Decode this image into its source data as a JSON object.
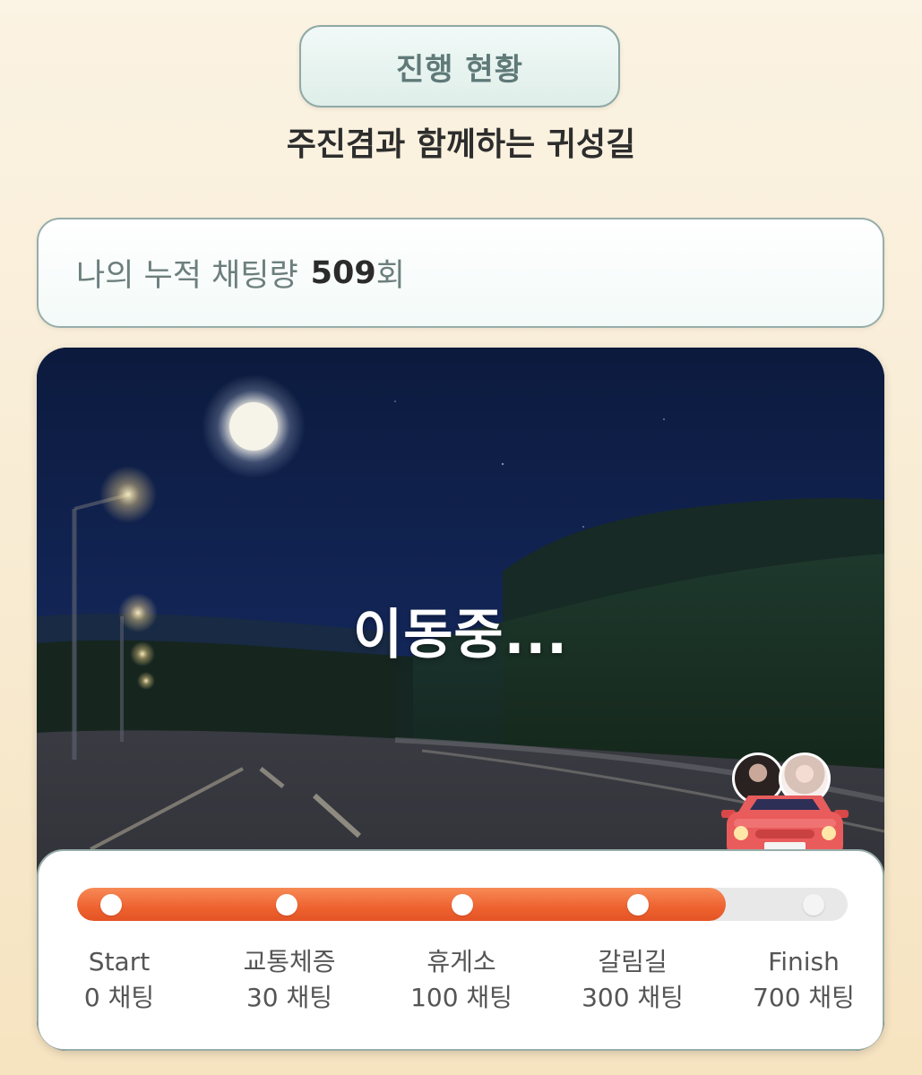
{
  "header": {
    "title": "진행 현황",
    "subtitle": "주진겸과 함께하는 귀성길"
  },
  "stats": {
    "label": "나의 누적 채팅량",
    "value": "509",
    "unit": "회"
  },
  "scene": {
    "status_text": "이동중..."
  },
  "progress": {
    "fill_fraction": 0.842,
    "milestones": [
      {
        "name": "Start",
        "requirement": "0 채팅",
        "reached": true
      },
      {
        "name": "교통체증",
        "requirement": "30 채팅",
        "reached": true
      },
      {
        "name": "휴게소",
        "requirement": "100 채팅",
        "reached": true
      },
      {
        "name": "갈림길",
        "requirement": "300 채팅",
        "reached": true
      },
      {
        "name": "Finish",
        "requirement": "700 채팅",
        "reached": false
      }
    ]
  },
  "colors": {
    "accent_orange": "#ee6230",
    "card_border": "#97ada9",
    "car_red": "#e85a5a"
  },
  "icons": {
    "car": "car-icon",
    "avatar_1": "avatar-icon",
    "avatar_2": "avatar-icon"
  }
}
